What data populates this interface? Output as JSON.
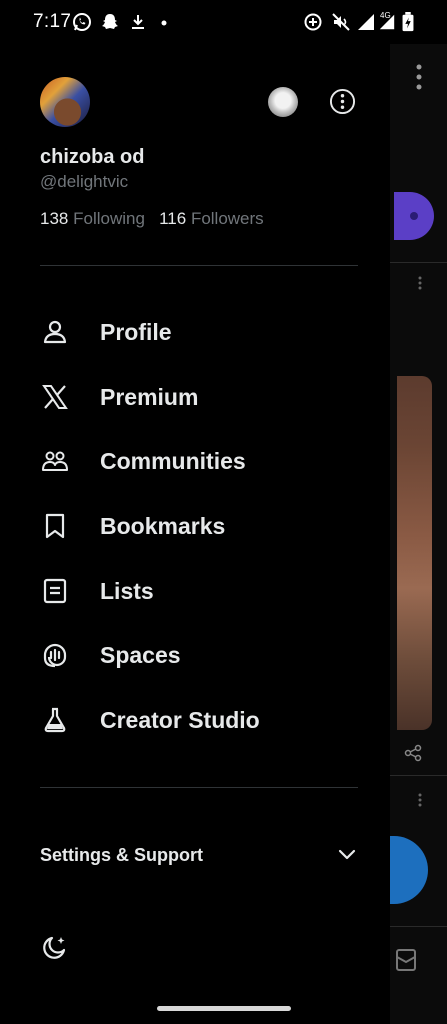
{
  "status_bar": {
    "time": "7:17",
    "network_label": "4G"
  },
  "profile": {
    "display_name": "chizoba od",
    "handle": "@delightvic",
    "following_count": "138",
    "following_label": "Following",
    "followers_count": "116",
    "followers_label": "Followers"
  },
  "menu": [
    {
      "label": "Profile",
      "icon": "person-icon"
    },
    {
      "label": "Premium",
      "icon": "x-logo-icon"
    },
    {
      "label": "Communities",
      "icon": "communities-icon"
    },
    {
      "label": "Bookmarks",
      "icon": "bookmark-icon"
    },
    {
      "label": "Lists",
      "icon": "list-icon"
    },
    {
      "label": "Spaces",
      "icon": "spaces-icon"
    },
    {
      "label": "Creator Studio",
      "icon": "flask-icon"
    }
  ],
  "settings": {
    "label": "Settings & Support"
  },
  "colors": {
    "background": "#000000",
    "text_primary": "#e7e9ea",
    "text_secondary": "#71767b",
    "divider": "#2f3336"
  }
}
